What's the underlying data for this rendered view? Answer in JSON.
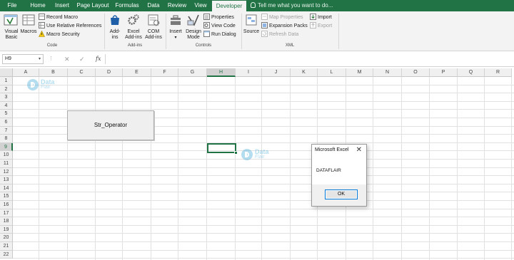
{
  "ribbon_tabs": [
    {
      "label": "File"
    },
    {
      "label": "Home"
    },
    {
      "label": "Insert"
    },
    {
      "label": "Page Layout"
    },
    {
      "label": "Formulas"
    },
    {
      "label": "Data"
    },
    {
      "label": "Review"
    },
    {
      "label": "View"
    },
    {
      "label": "Developer",
      "active": true
    }
  ],
  "tell_me": "Tell me what you want to do...",
  "groups": {
    "code": {
      "label": "Code",
      "visual_basic": "Visual Basic",
      "macros": "Macros",
      "record_macro": "Record Macro",
      "relative_refs": "Use Relative References",
      "macro_security": "Macro Security"
    },
    "addins": {
      "label": "Add-ins",
      "addins": "Add- ins",
      "excel_addins": "Excel Add-ins",
      "com_addins": "COM Add-ins"
    },
    "controls": {
      "label": "Controls",
      "insert": "Insert",
      "design_mode": "Design Mode",
      "properties": "Properties",
      "view_code": "View Code",
      "run_dialog": "Run Dialog"
    },
    "xml": {
      "label": "XML",
      "source": "Source",
      "map_properties": "Map Properties",
      "expansion_packs": "Expansion Packs",
      "refresh_data": "Refresh Data",
      "import": "Import",
      "export": "Export"
    }
  },
  "formula_bar": {
    "name_box": "H9",
    "cancel": "✕",
    "enter": "✓",
    "fx": "fx",
    "formula": ""
  },
  "columns": [
    "A",
    "B",
    "C",
    "D",
    "E",
    "F",
    "G",
    "H",
    "I",
    "J",
    "K",
    "L",
    "M",
    "N",
    "O",
    "P",
    "Q",
    "R"
  ],
  "rows": [
    "1",
    "2",
    "3",
    "4",
    "5",
    "6",
    "7",
    "8",
    "9",
    "10",
    "11",
    "12",
    "13",
    "14",
    "15",
    "16",
    "17",
    "18",
    "19",
    "20",
    "21",
    "22"
  ],
  "selected_cell": "H9",
  "sheet_button": {
    "label": "Str_Operator"
  },
  "message_box": {
    "title": "Microsoft Excel",
    "close": "✕",
    "message": "DATAFLAIR",
    "ok": "OK"
  },
  "watermark": {
    "line1": "Data",
    "line2": "Flair"
  },
  "colors": {
    "ribbon_green": "#217346",
    "ribbon_bg": "#f3f3f3",
    "selection": "#217346"
  }
}
